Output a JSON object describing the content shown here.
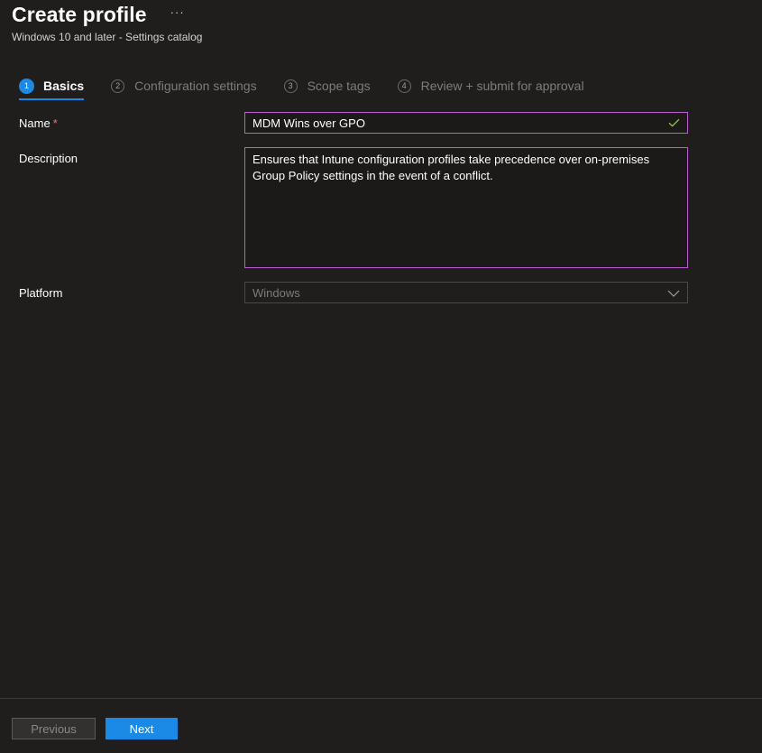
{
  "header": {
    "title": "Create profile",
    "more_label": "···",
    "subtitle": "Windows 10 and later - Settings catalog"
  },
  "wizard": {
    "steps": [
      {
        "number": "1",
        "label": "Basics",
        "active": true
      },
      {
        "number": "2",
        "label": "Configuration settings",
        "active": false
      },
      {
        "number": "3",
        "label": "Scope tags",
        "active": false
      },
      {
        "number": "4",
        "label": "Review + submit for approval",
        "active": false
      }
    ]
  },
  "form": {
    "name": {
      "label": "Name",
      "required_marker": "*",
      "value": "MDM Wins over GPO",
      "valid_icon": "checkmark-icon"
    },
    "description": {
      "label": "Description",
      "value": "Ensures that Intune configuration profiles take precedence over on-premises Group Policy settings in the event of a conflict."
    },
    "platform": {
      "label": "Platform",
      "value": "Windows",
      "icon": "chevron-down-icon"
    }
  },
  "footer": {
    "previous_label": "Previous",
    "next_label": "Next"
  },
  "colors": {
    "background": "#1f1e1d",
    "accent": "#1b8ae6",
    "input_border": "#b95fd1",
    "required": "#f1707b",
    "valid_check": "#92c353"
  }
}
